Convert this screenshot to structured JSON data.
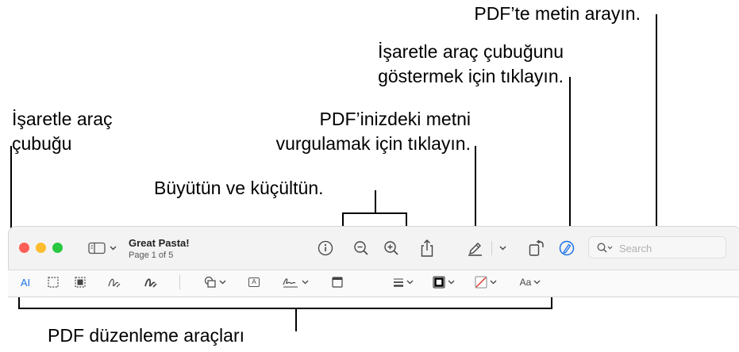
{
  "callouts": {
    "search_pdf": "PDF’te metin arayın.",
    "markup_show_line1": "İşaretle araç çubuğunu",
    "markup_show_line2": "göstermek için tıklayın.",
    "markup_toolbar_line1": "İşaretle araç",
    "markup_toolbar_line2": "çubuğu",
    "highlight_line1": "PDF’inizdeki metni",
    "highlight_line2": "vurgulamak için tıklayın.",
    "zoom": "Büyütün ve küçültün.",
    "edit_tools": "PDF düzenleme araçları"
  },
  "window": {
    "title": "Great Pasta!",
    "subtitle": "Page 1 of 5",
    "search_placeholder": "Search"
  },
  "colors": {
    "close": "#fe5f57",
    "minimize": "#febc2e",
    "zoom": "#28c840",
    "accent": "#1a73e8"
  },
  "toolbar_icons": [
    "sidebar-icon",
    "info-icon",
    "zoom-out-icon",
    "zoom-in-icon",
    "share-icon",
    "highlight-pen-icon",
    "rotate-icon",
    "markup-icon",
    "search-icon"
  ],
  "markup_icons": [
    "text-selection-icon",
    "rect-selection-icon",
    "smart-lasso-icon",
    "sketch-icon",
    "draw-icon",
    "shapes-icon",
    "text-box-icon",
    "sign-icon",
    "note-icon",
    "shape-style-icon",
    "border-color-icon",
    "fill-color-icon",
    "text-style-icon"
  ],
  "markup_text": {
    "text_select_glyph": "A",
    "text_box_glyph": "A",
    "text_style_glyph": "Aa"
  }
}
